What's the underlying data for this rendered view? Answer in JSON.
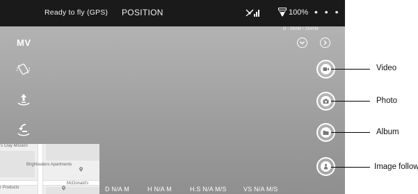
{
  "topbar": {
    "status": "Ready to fly (GPS)",
    "mode": "POSITION",
    "signal_icon": "remote-signal-icon",
    "battery_icon": "drone-battery-icon",
    "battery": "100%",
    "more": "• • •"
  },
  "readout": {
    "distance": "D : 560M / 1540M"
  },
  "mode_label": "MV",
  "left_icons": [
    "rotate-gimbal-icon",
    "takeoff-icon",
    "return-home-icon"
  ],
  "top_right_icons": [
    "chevron-down-icon",
    "chevron-right-icon"
  ],
  "right_buttons": [
    {
      "icon": "video-icon",
      "callout": "Video"
    },
    {
      "icon": "camera-icon",
      "callout": "Photo"
    },
    {
      "icon": "folder-icon",
      "callout": "Album"
    },
    {
      "icon": "person-follow-icon",
      "callout": "Image follow"
    }
  ],
  "telemetry": {
    "d": "D N/A M",
    "h": "H N/A M",
    "hs": "H.S N/A M/S",
    "vs": "VS  N/A M/S"
  },
  "map": {
    "label_top": "'s Clay Mission",
    "label_apartments": "Brightwaters Apartments",
    "label_mcdonalds": "McDonald's",
    "label_products": "r Products"
  },
  "colors": {
    "topbar": "#1a1a1a",
    "screen": "#a5a5a5",
    "icon": "#ffffff",
    "map_pin": "#8a8a8a"
  }
}
